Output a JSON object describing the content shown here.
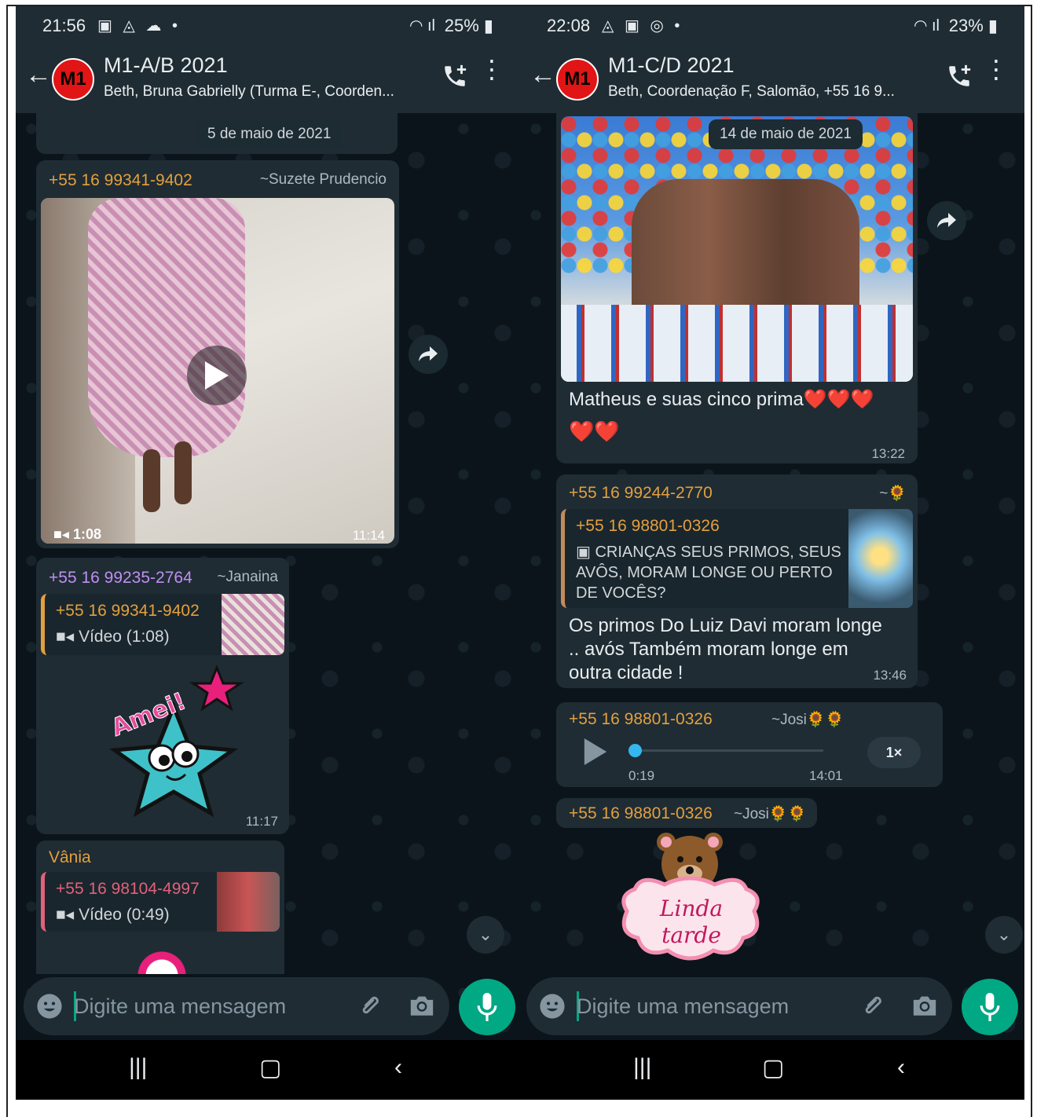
{
  "left": {
    "status": {
      "time": "21:56",
      "battery": "25%"
    },
    "header": {
      "title": "M1-A/B 2021",
      "subtitle": "Beth, Bruna Gabrielly (Turma E-, Coorden...",
      "avatar": "M1"
    },
    "date_pill": "5 de maio de 2021",
    "msg1": {
      "sender": "+55 16 99341-9402",
      "name": "~Suzete Prudencio",
      "duration": "1:08",
      "time": "11:14"
    },
    "msg2": {
      "sender": "+55 16 99235-2764",
      "name": "~Janaina",
      "quote_sender": "+55 16 99341-9402",
      "quote_text": "Vídeo (1:08)",
      "sticker_text": "Amei!",
      "time": "11:17"
    },
    "msg3": {
      "sender": "Vânia",
      "quote_sender": "+55 16 98104-4997",
      "quote_text": "Vídeo (0:49)"
    },
    "input_placeholder": "Digite uma mensagem"
  },
  "right": {
    "status": {
      "time": "22:08",
      "battery": "23%"
    },
    "header": {
      "title": "M1-C/D 2021",
      "subtitle": "Beth, Coordenação F, Salomão, +55 16 9...",
      "avatar": "M1"
    },
    "date_pill": "14 de maio de 2021",
    "msg1": {
      "caption": "Matheus e suas cinco prima❤️❤️❤️",
      "caption2": "❤️❤️",
      "time": "13:22"
    },
    "msg2": {
      "sender": "+55 16 99244-2770",
      "name": "~🌻",
      "quote_sender": "+55 16 98801-0326",
      "quote_text": "CRIANÇAS SEUS PRIMOS, SEUS AVÔS, MORAM LONGE OU PERTO DE VOCÊS?",
      "body": "Os primos  Do Luiz Davi moram longe .. avós Também moram longe em outra cidade !",
      "time": "13:46"
    },
    "msg3": {
      "sender": "+55 16 98801-0326",
      "name": "~Josi🌻🌻",
      "elapsed": "0:19",
      "speed": "1×",
      "time": "14:01",
      "progress": 0.0
    },
    "msg4": {
      "sender": "+55 16 98801-0326",
      "name": "~Josi🌻🌻",
      "sticker_line1": "Linda",
      "sticker_line2": "tarde"
    },
    "input_placeholder": "Digite uma mensagem"
  },
  "colors": {
    "bg": "#0b141a",
    "bubble": "#1f2c34",
    "accent": "#00a884",
    "orange": "#e3a03e",
    "purple": "#c08ff0",
    "pink": "#e2617a"
  }
}
